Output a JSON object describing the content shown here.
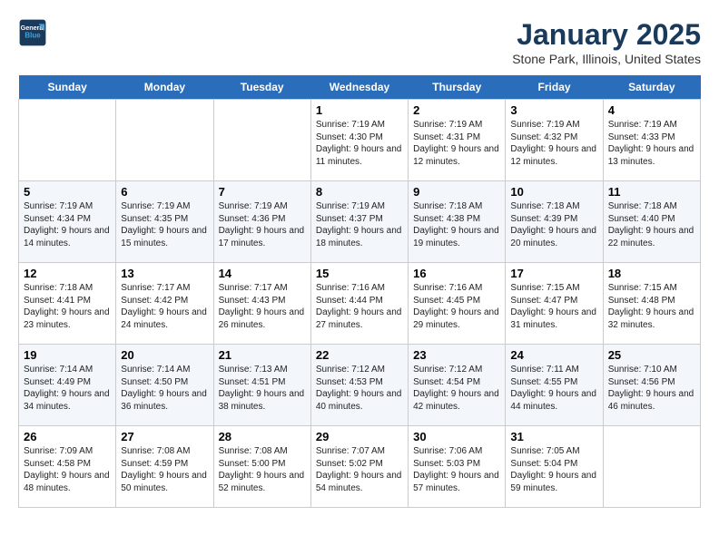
{
  "logo": {
    "line1": "General",
    "line2": "Blue"
  },
  "title": "January 2025",
  "subtitle": "Stone Park, Illinois, United States",
  "days": [
    "Sunday",
    "Monday",
    "Tuesday",
    "Wednesday",
    "Thursday",
    "Friday",
    "Saturday"
  ],
  "weeks": [
    [
      {
        "date": "",
        "sunrise": "",
        "sunset": "",
        "daylight": ""
      },
      {
        "date": "",
        "sunrise": "",
        "sunset": "",
        "daylight": ""
      },
      {
        "date": "",
        "sunrise": "",
        "sunset": "",
        "daylight": ""
      },
      {
        "date": "1",
        "sunrise": "Sunrise: 7:19 AM",
        "sunset": "Sunset: 4:30 PM",
        "daylight": "Daylight: 9 hours and 11 minutes."
      },
      {
        "date": "2",
        "sunrise": "Sunrise: 7:19 AM",
        "sunset": "Sunset: 4:31 PM",
        "daylight": "Daylight: 9 hours and 12 minutes."
      },
      {
        "date": "3",
        "sunrise": "Sunrise: 7:19 AM",
        "sunset": "Sunset: 4:32 PM",
        "daylight": "Daylight: 9 hours and 12 minutes."
      },
      {
        "date": "4",
        "sunrise": "Sunrise: 7:19 AM",
        "sunset": "Sunset: 4:33 PM",
        "daylight": "Daylight: 9 hours and 13 minutes."
      }
    ],
    [
      {
        "date": "5",
        "sunrise": "Sunrise: 7:19 AM",
        "sunset": "Sunset: 4:34 PM",
        "daylight": "Daylight: 9 hours and 14 minutes."
      },
      {
        "date": "6",
        "sunrise": "Sunrise: 7:19 AM",
        "sunset": "Sunset: 4:35 PM",
        "daylight": "Daylight: 9 hours and 15 minutes."
      },
      {
        "date": "7",
        "sunrise": "Sunrise: 7:19 AM",
        "sunset": "Sunset: 4:36 PM",
        "daylight": "Daylight: 9 hours and 17 minutes."
      },
      {
        "date": "8",
        "sunrise": "Sunrise: 7:19 AM",
        "sunset": "Sunset: 4:37 PM",
        "daylight": "Daylight: 9 hours and 18 minutes."
      },
      {
        "date": "9",
        "sunrise": "Sunrise: 7:18 AM",
        "sunset": "Sunset: 4:38 PM",
        "daylight": "Daylight: 9 hours and 19 minutes."
      },
      {
        "date": "10",
        "sunrise": "Sunrise: 7:18 AM",
        "sunset": "Sunset: 4:39 PM",
        "daylight": "Daylight: 9 hours and 20 minutes."
      },
      {
        "date": "11",
        "sunrise": "Sunrise: 7:18 AM",
        "sunset": "Sunset: 4:40 PM",
        "daylight": "Daylight: 9 hours and 22 minutes."
      }
    ],
    [
      {
        "date": "12",
        "sunrise": "Sunrise: 7:18 AM",
        "sunset": "Sunset: 4:41 PM",
        "daylight": "Daylight: 9 hours and 23 minutes."
      },
      {
        "date": "13",
        "sunrise": "Sunrise: 7:17 AM",
        "sunset": "Sunset: 4:42 PM",
        "daylight": "Daylight: 9 hours and 24 minutes."
      },
      {
        "date": "14",
        "sunrise": "Sunrise: 7:17 AM",
        "sunset": "Sunset: 4:43 PM",
        "daylight": "Daylight: 9 hours and 26 minutes."
      },
      {
        "date": "15",
        "sunrise": "Sunrise: 7:16 AM",
        "sunset": "Sunset: 4:44 PM",
        "daylight": "Daylight: 9 hours and 27 minutes."
      },
      {
        "date": "16",
        "sunrise": "Sunrise: 7:16 AM",
        "sunset": "Sunset: 4:45 PM",
        "daylight": "Daylight: 9 hours and 29 minutes."
      },
      {
        "date": "17",
        "sunrise": "Sunrise: 7:15 AM",
        "sunset": "Sunset: 4:47 PM",
        "daylight": "Daylight: 9 hours and 31 minutes."
      },
      {
        "date": "18",
        "sunrise": "Sunrise: 7:15 AM",
        "sunset": "Sunset: 4:48 PM",
        "daylight": "Daylight: 9 hours and 32 minutes."
      }
    ],
    [
      {
        "date": "19",
        "sunrise": "Sunrise: 7:14 AM",
        "sunset": "Sunset: 4:49 PM",
        "daylight": "Daylight: 9 hours and 34 minutes."
      },
      {
        "date": "20",
        "sunrise": "Sunrise: 7:14 AM",
        "sunset": "Sunset: 4:50 PM",
        "daylight": "Daylight: 9 hours and 36 minutes."
      },
      {
        "date": "21",
        "sunrise": "Sunrise: 7:13 AM",
        "sunset": "Sunset: 4:51 PM",
        "daylight": "Daylight: 9 hours and 38 minutes."
      },
      {
        "date": "22",
        "sunrise": "Sunrise: 7:12 AM",
        "sunset": "Sunset: 4:53 PM",
        "daylight": "Daylight: 9 hours and 40 minutes."
      },
      {
        "date": "23",
        "sunrise": "Sunrise: 7:12 AM",
        "sunset": "Sunset: 4:54 PM",
        "daylight": "Daylight: 9 hours and 42 minutes."
      },
      {
        "date": "24",
        "sunrise": "Sunrise: 7:11 AM",
        "sunset": "Sunset: 4:55 PM",
        "daylight": "Daylight: 9 hours and 44 minutes."
      },
      {
        "date": "25",
        "sunrise": "Sunrise: 7:10 AM",
        "sunset": "Sunset: 4:56 PM",
        "daylight": "Daylight: 9 hours and 46 minutes."
      }
    ],
    [
      {
        "date": "26",
        "sunrise": "Sunrise: 7:09 AM",
        "sunset": "Sunset: 4:58 PM",
        "daylight": "Daylight: 9 hours and 48 minutes."
      },
      {
        "date": "27",
        "sunrise": "Sunrise: 7:08 AM",
        "sunset": "Sunset: 4:59 PM",
        "daylight": "Daylight: 9 hours and 50 minutes."
      },
      {
        "date": "28",
        "sunrise": "Sunrise: 7:08 AM",
        "sunset": "Sunset: 5:00 PM",
        "daylight": "Daylight: 9 hours and 52 minutes."
      },
      {
        "date": "29",
        "sunrise": "Sunrise: 7:07 AM",
        "sunset": "Sunset: 5:02 PM",
        "daylight": "Daylight: 9 hours and 54 minutes."
      },
      {
        "date": "30",
        "sunrise": "Sunrise: 7:06 AM",
        "sunset": "Sunset: 5:03 PM",
        "daylight": "Daylight: 9 hours and 57 minutes."
      },
      {
        "date": "31",
        "sunrise": "Sunrise: 7:05 AM",
        "sunset": "Sunset: 5:04 PM",
        "daylight": "Daylight: 9 hours and 59 minutes."
      },
      {
        "date": "",
        "sunrise": "",
        "sunset": "",
        "daylight": ""
      }
    ]
  ]
}
